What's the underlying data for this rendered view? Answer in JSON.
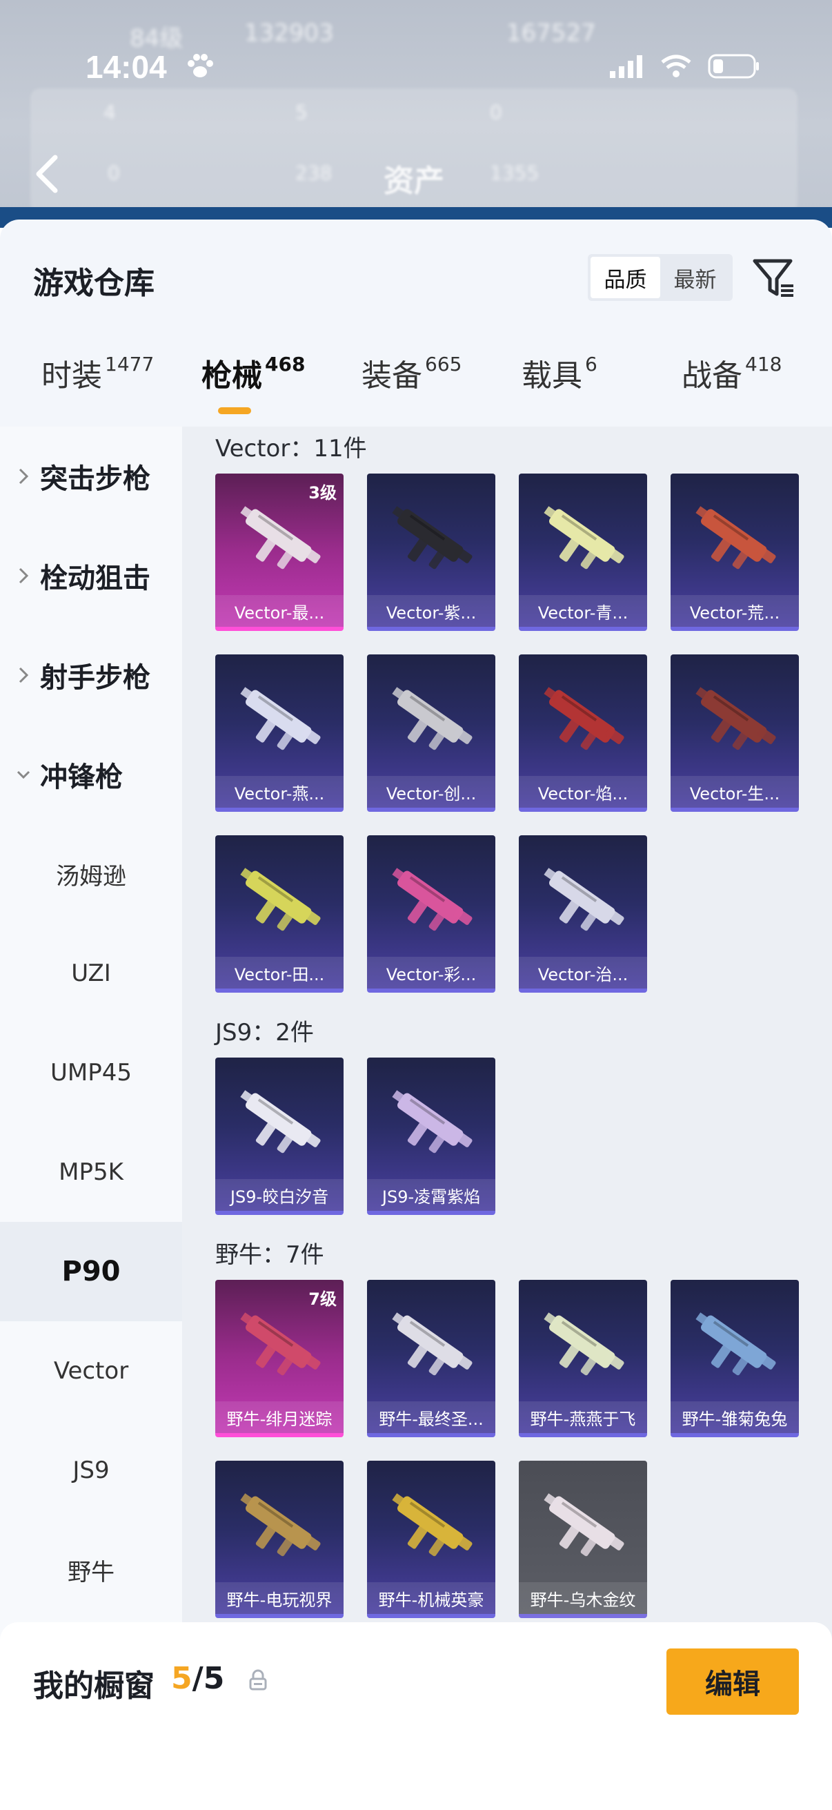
{
  "status_bar": {
    "time": "14:04"
  },
  "header_background": {
    "title": "资产",
    "blurred_stats": [
      "84级",
      "132903",
      "167527",
      "4",
      "5",
      "0",
      "0",
      "238",
      "1355"
    ]
  },
  "sheet": {
    "title": "游戏仓库",
    "sort_options": [
      {
        "label": "品质",
        "active": true
      },
      {
        "label": "最新",
        "active": false
      }
    ]
  },
  "tabs": [
    {
      "label": "时装",
      "count": "1477",
      "active": false
    },
    {
      "label": "枪械",
      "count": "468",
      "active": true
    },
    {
      "label": "装备",
      "count": "665",
      "active": false
    },
    {
      "label": "载具",
      "count": "6",
      "active": false
    },
    {
      "label": "战备",
      "count": "418",
      "active": false
    }
  ],
  "left_nav": {
    "categories": [
      {
        "label": "突击步枪",
        "expanded": false
      },
      {
        "label": "栓动狙击",
        "expanded": false
      },
      {
        "label": "射手步枪",
        "expanded": false
      },
      {
        "label": "冲锋枪",
        "expanded": true
      }
    ],
    "sub_items": [
      {
        "label": "汤姆逊",
        "selected": false
      },
      {
        "label": "UZI",
        "selected": false
      },
      {
        "label": "UMP45",
        "selected": false
      },
      {
        "label": "MP5K",
        "selected": false
      },
      {
        "label": "P90",
        "selected": true
      },
      {
        "label": "Vector",
        "selected": false
      },
      {
        "label": "JS9",
        "selected": false
      },
      {
        "label": "野牛",
        "selected": false
      }
    ]
  },
  "sections": [
    {
      "heading": "Vector：11件",
      "items": [
        {
          "label": "Vector-最...",
          "level": "3级",
          "style": "pink"
        },
        {
          "label": "Vector-紫...",
          "style": "purple"
        },
        {
          "label": "Vector-青...",
          "style": "purple"
        },
        {
          "label": "Vector-荒...",
          "style": "purple"
        },
        {
          "label": "Vector-燕...",
          "style": "purple"
        },
        {
          "label": "Vector-创...",
          "style": "purple"
        },
        {
          "label": "Vector-焰...",
          "style": "purple"
        },
        {
          "label": "Vector-生...",
          "style": "purple"
        },
        {
          "label": "Vector-田...",
          "style": "purple"
        },
        {
          "label": "Vector-彩...",
          "style": "purple"
        },
        {
          "label": "Vector-治...",
          "style": "purple"
        }
      ]
    },
    {
      "heading": "JS9：2件",
      "items": [
        {
          "label": "JS9-皎白汐音",
          "style": "purple"
        },
        {
          "label": "JS9-凌霄紫焰",
          "style": "purple"
        }
      ]
    },
    {
      "heading": "野牛：7件",
      "items": [
        {
          "label": "野牛-绯月迷踪",
          "level": "7级",
          "style": "pink"
        },
        {
          "label": "野牛-最终圣...",
          "style": "purple"
        },
        {
          "label": "野牛-燕燕于飞",
          "style": "purple"
        },
        {
          "label": "野牛-雏菊兔兔",
          "style": "purple"
        },
        {
          "label": "野牛-电玩视界",
          "style": "purple"
        },
        {
          "label": "野牛-机械英豪",
          "style": "purple"
        },
        {
          "label": "野牛-乌木金纹",
          "style": "gray"
        }
      ]
    }
  ],
  "showcase": {
    "title": "我的橱窗",
    "current": "5",
    "separator": "/5",
    "edit_label": "编辑"
  },
  "icons": {
    "filter": "filter-icon",
    "share": "share-external-icon",
    "lock": "lock-icon",
    "back": "back-arrow-icon"
  },
  "colors": {
    "accent": "#f5a623",
    "card_purple": "#2a2d66",
    "card_pink": "#c23ab4",
    "card_gray": "#5c5e66"
  }
}
